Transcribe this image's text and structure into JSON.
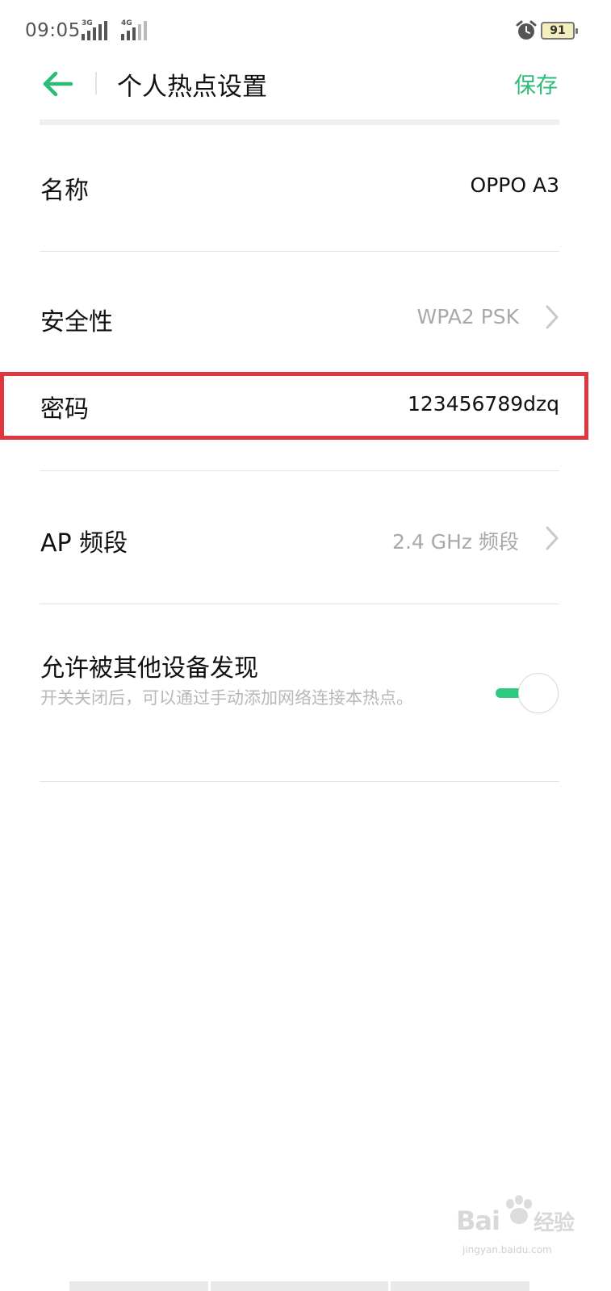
{
  "status_bar": {
    "time": "09:05",
    "signal1_label": "3G",
    "signal2_label": "4G",
    "battery_level": "91"
  },
  "header": {
    "title": "个人热点设置",
    "save_label": "保存"
  },
  "settings": {
    "name": {
      "label": "名称",
      "value": "OPPO A3"
    },
    "security": {
      "label": "安全性",
      "value": "WPA2 PSK"
    },
    "password": {
      "label": "密码",
      "value": "123456789dzq"
    },
    "ap_band": {
      "label": "AP 频段",
      "value": "2.4 GHz 频段"
    },
    "discoverable": {
      "label": "允许被其他设备发现",
      "description": "开关关闭后，可以通过手动添加网络连接本热点。",
      "enabled": true
    }
  },
  "watermark": {
    "logo": "Bai",
    "logo_tail": "经验",
    "url": "jingyan.baidu.com"
  },
  "colors": {
    "accent": "#2dbb78",
    "highlight_border": "#e0363f"
  }
}
